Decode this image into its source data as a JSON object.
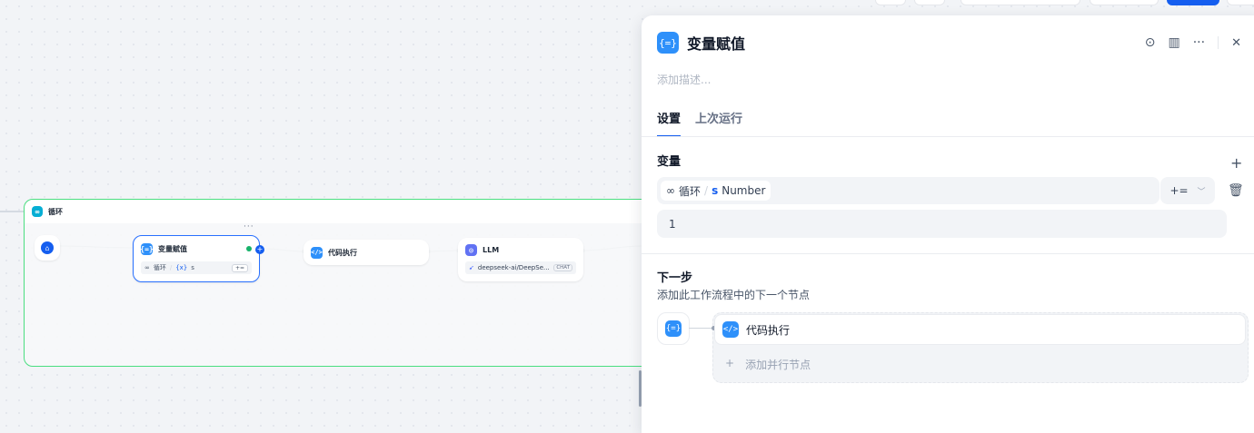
{
  "canvas": {
    "loop_title": "循环",
    "assign_node": {
      "title": "变量赋值",
      "var_loop": "循环",
      "var_x": "{x}",
      "var_name": "s",
      "op": "+="
    },
    "more": "···",
    "code_node": {
      "title": "代码执行"
    },
    "llm_node": {
      "title": "LLM",
      "model": "deepseek-ai/DeepSe...",
      "badge": "CHAT"
    }
  },
  "panel": {
    "title": "变量赋值",
    "description_placeholder": "添加描述...",
    "tabs": [
      "设置",
      "上次运行"
    ],
    "variables": {
      "section_title": "变量",
      "loop": "循环",
      "var_name": "s",
      "var_type": "Number",
      "operator": "+=",
      "value": "1"
    },
    "next_step": {
      "title": "下一步",
      "subtitle": "添加此工作流程中的下一个节点",
      "next_node": "代码执行",
      "add_parallel": "添加并行节点"
    }
  },
  "colors": {
    "accent": "#155eef",
    "loop_border": "#4ade80",
    "success": "#17b26a"
  }
}
